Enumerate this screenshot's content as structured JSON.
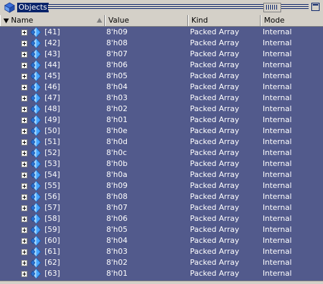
{
  "window": {
    "title": "Objects",
    "icon": "objects-icon"
  },
  "columns": {
    "name": "Name",
    "value": "Value",
    "kind": "Kind",
    "mode": "Mode"
  },
  "rows": [
    {
      "name": "[41]",
      "value": "8'h09",
      "kind": "Packed Array",
      "mode": "Internal"
    },
    {
      "name": "[42]",
      "value": "8'h08",
      "kind": "Packed Array",
      "mode": "Internal"
    },
    {
      "name": "[43]",
      "value": "8'h07",
      "kind": "Packed Array",
      "mode": "Internal"
    },
    {
      "name": "[44]",
      "value": "8'h06",
      "kind": "Packed Array",
      "mode": "Internal"
    },
    {
      "name": "[45]",
      "value": "8'h05",
      "kind": "Packed Array",
      "mode": "Internal"
    },
    {
      "name": "[46]",
      "value": "8'h04",
      "kind": "Packed Array",
      "mode": "Internal"
    },
    {
      "name": "[47]",
      "value": "8'h03",
      "kind": "Packed Array",
      "mode": "Internal"
    },
    {
      "name": "[48]",
      "value": "8'h02",
      "kind": "Packed Array",
      "mode": "Internal"
    },
    {
      "name": "[49]",
      "value": "8'h01",
      "kind": "Packed Array",
      "mode": "Internal"
    },
    {
      "name": "[50]",
      "value": "8'h0e",
      "kind": "Packed Array",
      "mode": "Internal"
    },
    {
      "name": "[51]",
      "value": "8'h0d",
      "kind": "Packed Array",
      "mode": "Internal"
    },
    {
      "name": "[52]",
      "value": "8'h0c",
      "kind": "Packed Array",
      "mode": "Internal"
    },
    {
      "name": "[53]",
      "value": "8'h0b",
      "kind": "Packed Array",
      "mode": "Internal"
    },
    {
      "name": "[54]",
      "value": "8'h0a",
      "kind": "Packed Array",
      "mode": "Internal"
    },
    {
      "name": "[55]",
      "value": "8'h09",
      "kind": "Packed Array",
      "mode": "Internal"
    },
    {
      "name": "[56]",
      "value": "8'h08",
      "kind": "Packed Array",
      "mode": "Internal"
    },
    {
      "name": "[57]",
      "value": "8'h07",
      "kind": "Packed Array",
      "mode": "Internal"
    },
    {
      "name": "[58]",
      "value": "8'h06",
      "kind": "Packed Array",
      "mode": "Internal"
    },
    {
      "name": "[59]",
      "value": "8'h05",
      "kind": "Packed Array",
      "mode": "Internal"
    },
    {
      "name": "[60]",
      "value": "8'h04",
      "kind": "Packed Array",
      "mode": "Internal"
    },
    {
      "name": "[61]",
      "value": "8'h03",
      "kind": "Packed Array",
      "mode": "Internal"
    },
    {
      "name": "[62]",
      "value": "8'h02",
      "kind": "Packed Array",
      "mode": "Internal"
    },
    {
      "name": "[63]",
      "value": "8'h01",
      "kind": "Packed Array",
      "mode": "Internal"
    }
  ],
  "colors": {
    "list_bg": "#525a8c",
    "title_highlight": "#0a246a",
    "chrome": "#d4d0c8",
    "row_text": "#ffffff"
  },
  "row_icons": {
    "expand": "expand-plus-icon",
    "object": "array-object-icon"
  }
}
